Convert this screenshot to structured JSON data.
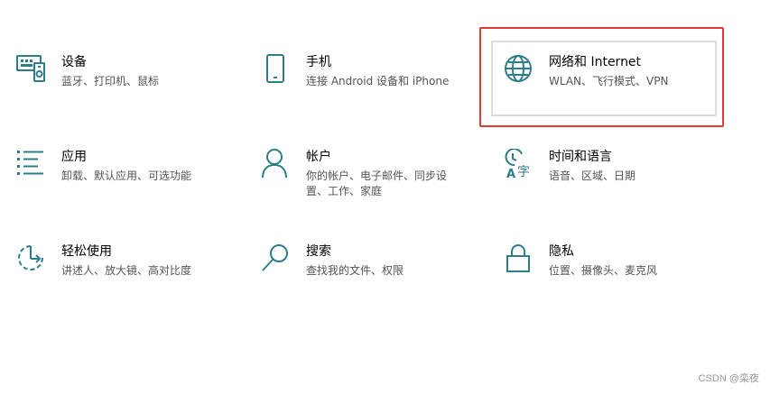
{
  "tiles": [
    {
      "title": "设备",
      "desc": "蓝牙、打印机、鼠标",
      "icon": "keyboard-device-icon"
    },
    {
      "title": "手机",
      "desc": "连接 Android 设备和 iPhone",
      "icon": "phone-icon"
    },
    {
      "title": "网络和 Internet",
      "desc": "WLAN、飞行模式、VPN",
      "icon": "globe-icon"
    },
    {
      "title": "应用",
      "desc": "卸载、默认应用、可选功能",
      "icon": "apps-list-icon"
    },
    {
      "title": "帐户",
      "desc": "你的帐户、电子邮件、同步设置、工作、家庭",
      "icon": "person-icon"
    },
    {
      "title": "时间和语言",
      "desc": "语音、区域、日期",
      "icon": "time-language-icon"
    },
    {
      "title": "轻松使用",
      "desc": "讲述人、放大镜、高对比度",
      "icon": "ease-of-access-icon"
    },
    {
      "title": "搜索",
      "desc": "查找我的文件、权限",
      "icon": "search-icon"
    },
    {
      "title": "隐私",
      "desc": "位置、摄像头、麦克风",
      "icon": "lock-icon"
    }
  ],
  "watermark": "CSDN @栾夜",
  "colors": {
    "icon": "#2d7d8a",
    "highlight": "#e53935"
  }
}
